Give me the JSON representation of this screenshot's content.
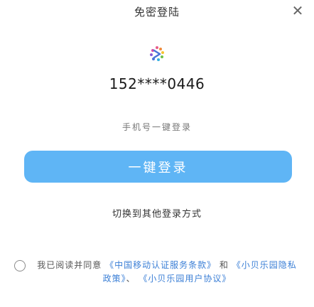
{
  "header": {
    "title": "免密登陆",
    "close_icon": "close-icon",
    "close_glyph": "✕"
  },
  "logo": {
    "icon": "app-logo-icon",
    "color": "#e85d8a"
  },
  "account": {
    "masked_phone": "152****0446"
  },
  "login": {
    "subtitle": "手机号一键登录",
    "button_label": "一键登录",
    "button_color": "#5fb5f5",
    "switch_label": "切换到其他登录方式"
  },
  "agreement": {
    "prefix": "我已阅读并同意",
    "carrier_link": "《中国移动认证服务条款》",
    "and": "和",
    "privacy_link": "《小贝乐园隐私政策》",
    "separator": "、",
    "user_link": "《小贝乐园用户协议》"
  }
}
